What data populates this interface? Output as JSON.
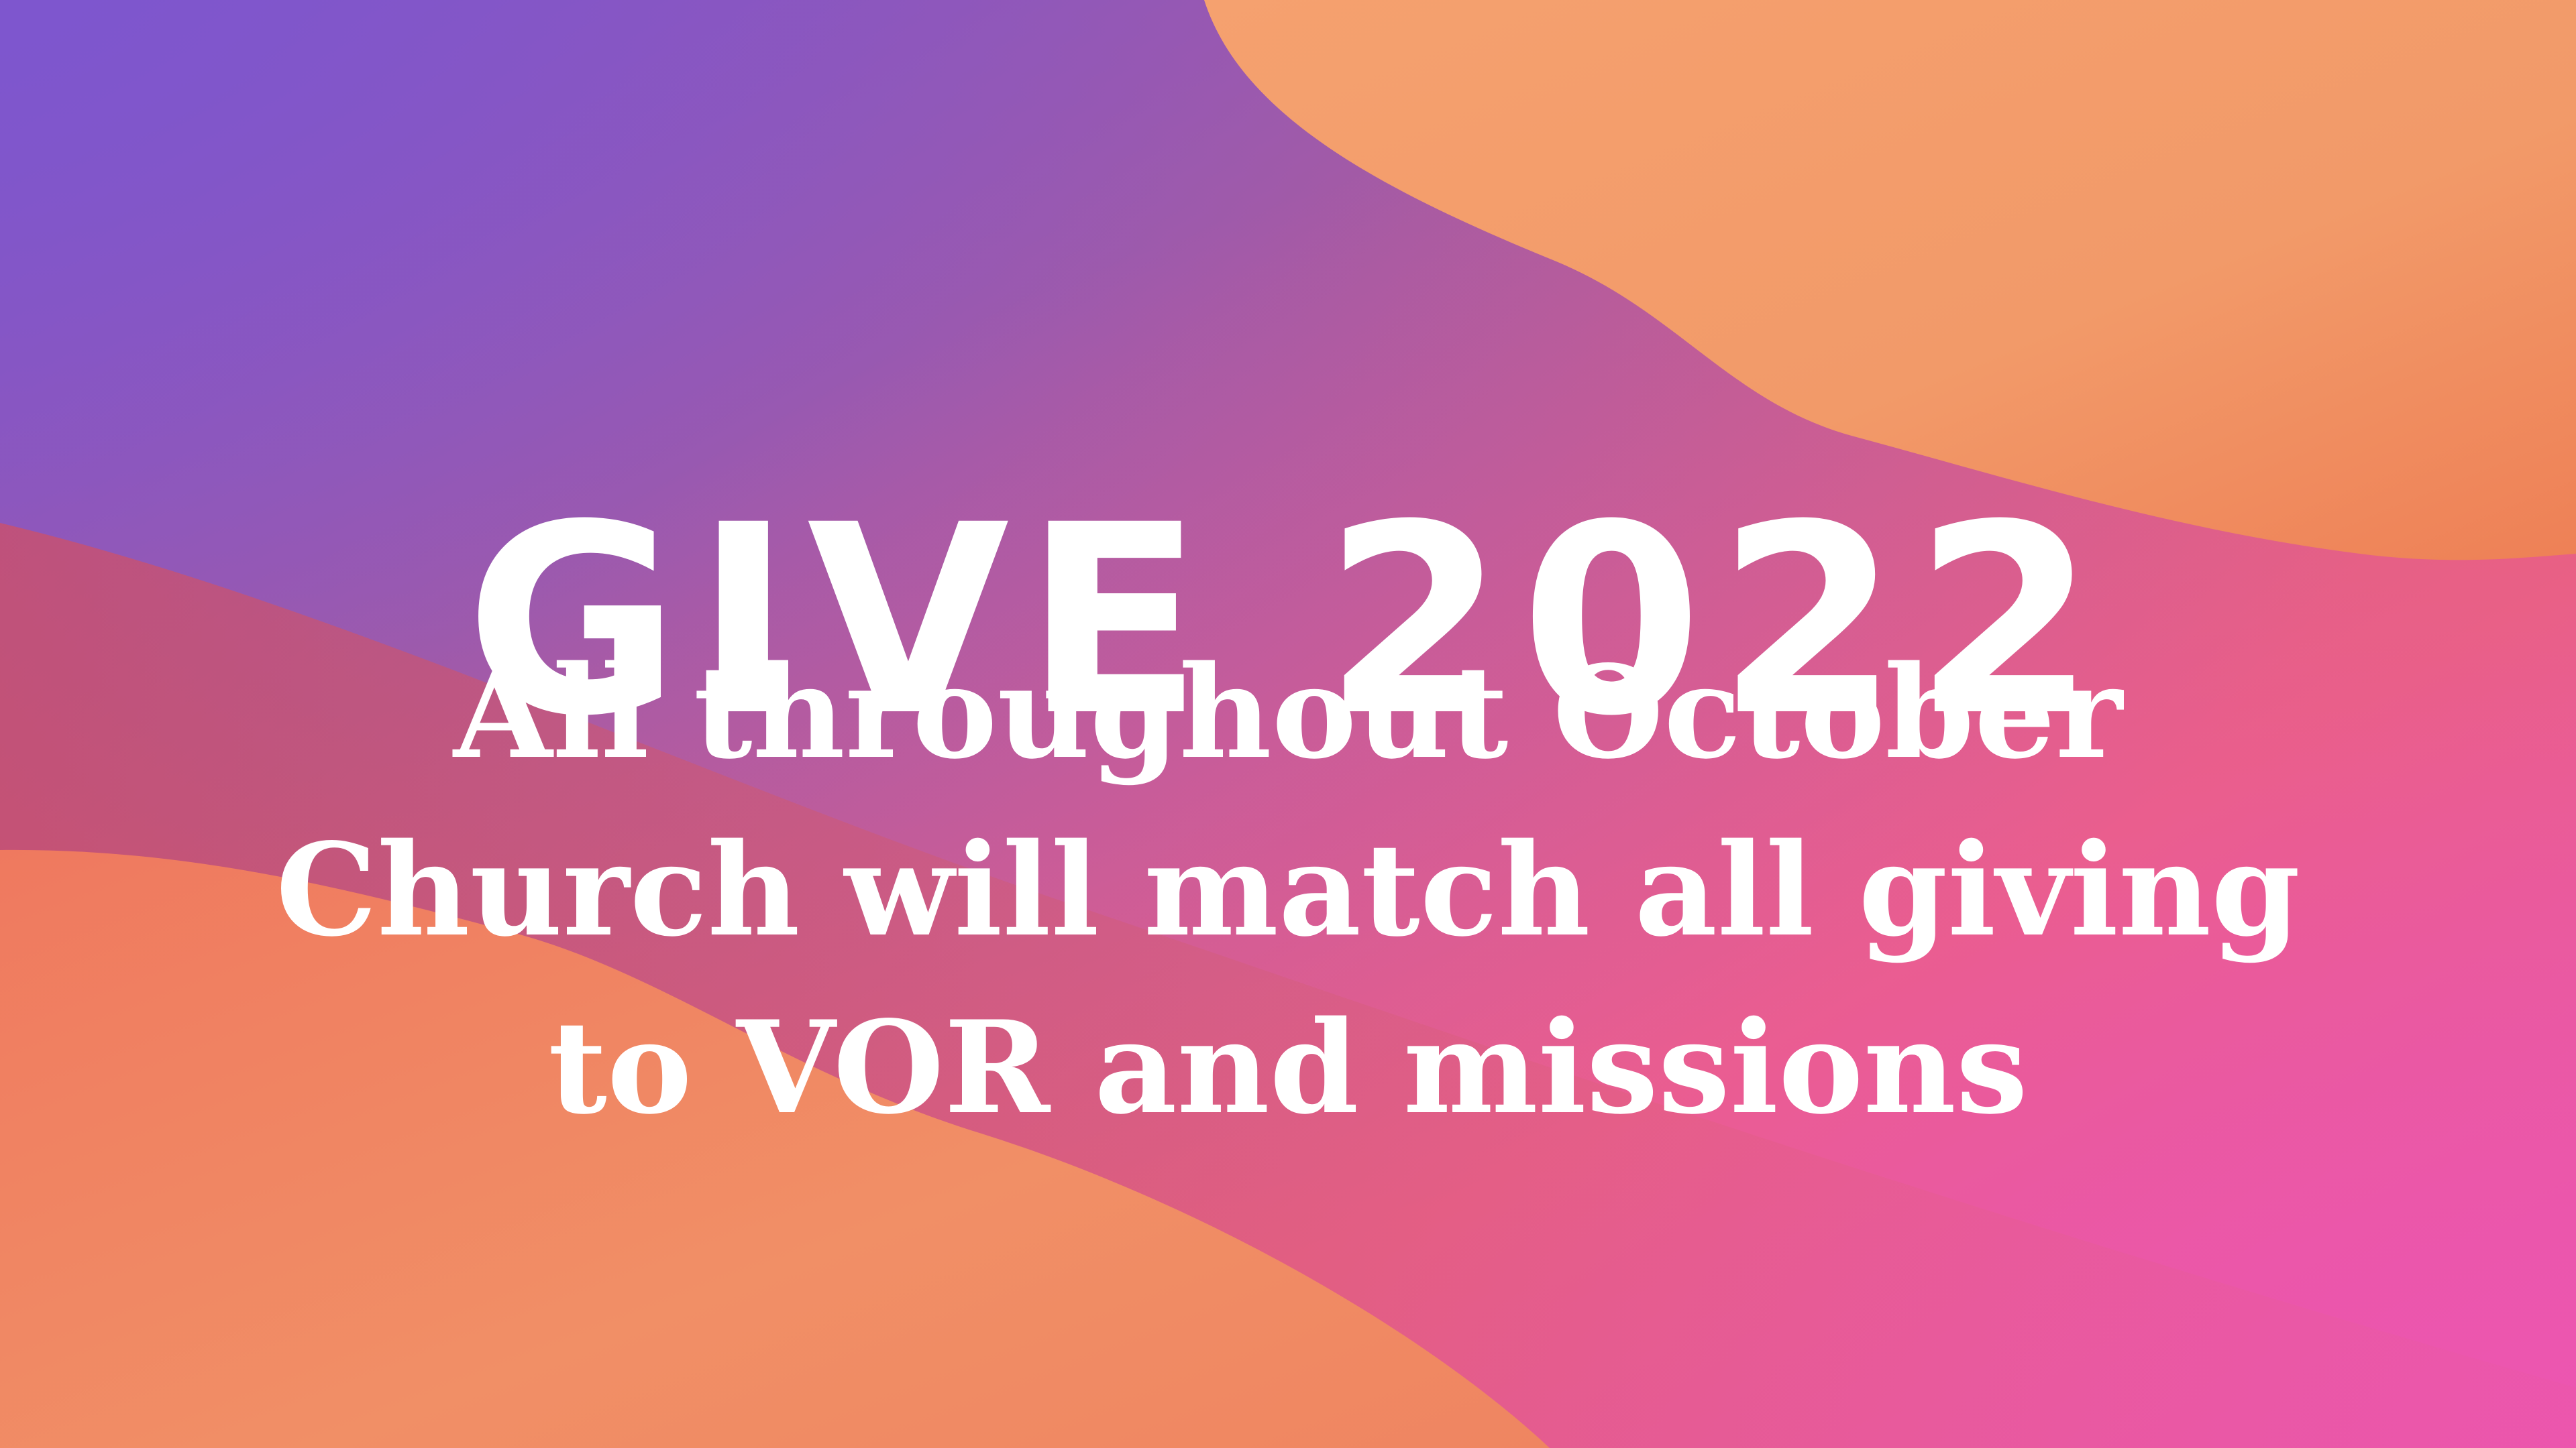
{
  "slide": {
    "title": "GIVE 2022",
    "message_lines": [
      "All throughout October",
      "Church will match all giving",
      "to VOR and missions"
    ],
    "colors": {
      "text": "#ffffff",
      "purple": "#8752c0",
      "rose": "#d8546f",
      "coral": "#ef795f",
      "peach": "#f4a06c",
      "pink": "#e858a8"
    }
  }
}
